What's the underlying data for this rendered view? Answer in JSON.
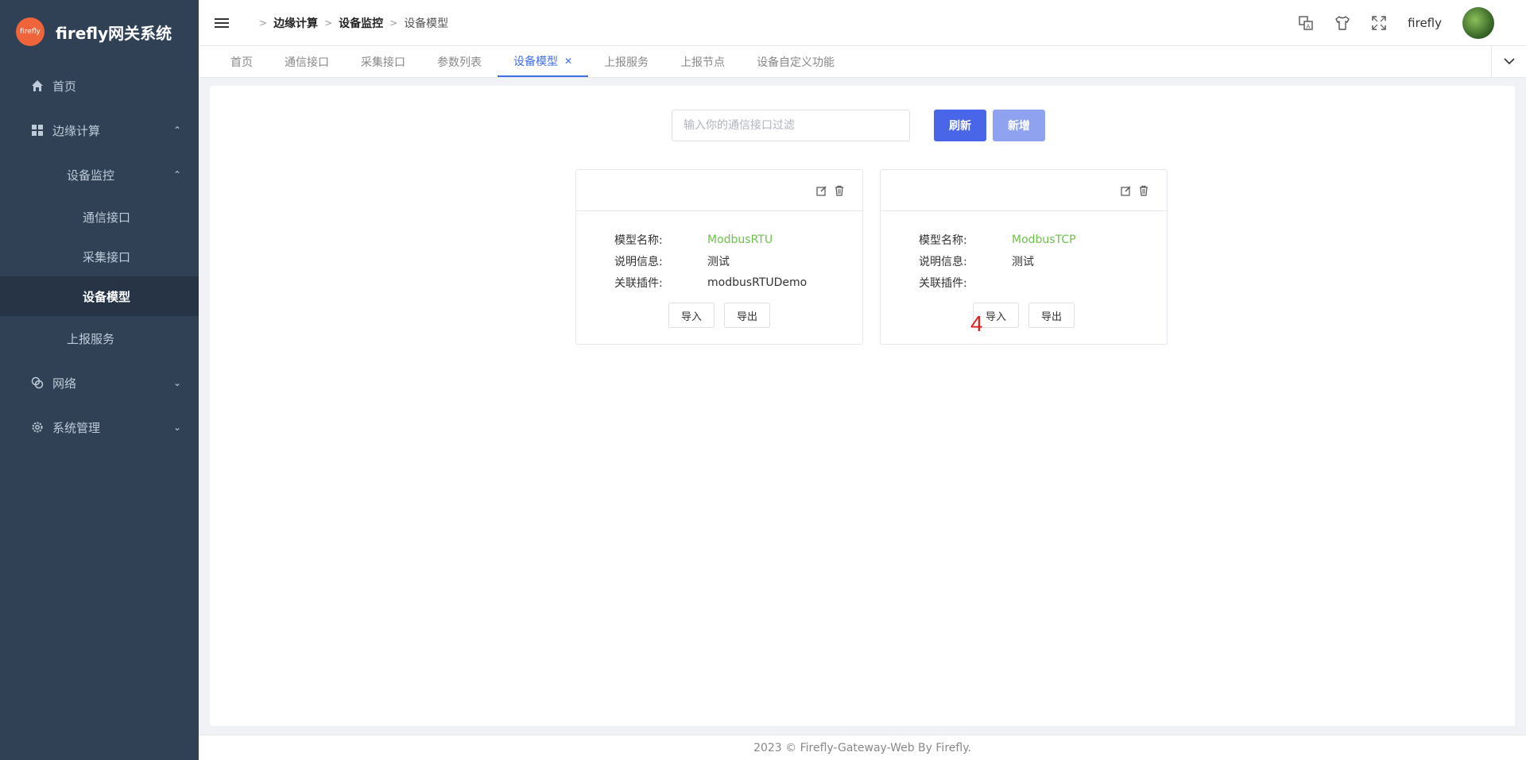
{
  "app": {
    "title": "firefly网关系统",
    "logo_text": "firefly"
  },
  "sidebar": {
    "items": [
      {
        "label": "首页",
        "icon": "home-icon"
      },
      {
        "label": "边缘计算",
        "icon": "grid-icon",
        "expanded": true
      },
      {
        "label": "设备监控",
        "expanded": true
      },
      {
        "label": "通信接口"
      },
      {
        "label": "采集接口"
      },
      {
        "label": "设备模型",
        "active": true
      },
      {
        "label": "上报服务"
      },
      {
        "label": "网络",
        "icon": "network-icon"
      },
      {
        "label": "系统管理",
        "icon": "gear-icon"
      }
    ]
  },
  "header": {
    "breadcrumb": [
      "边缘计算",
      "设备监控",
      "设备模型"
    ],
    "username": "firefly",
    "icons": [
      "translate-icon",
      "theme-shirt-icon",
      "fullscreen-icon"
    ]
  },
  "tabs": [
    {
      "label": "首页"
    },
    {
      "label": "通信接口"
    },
    {
      "label": "采集接口"
    },
    {
      "label": "参数列表"
    },
    {
      "label": "设备模型",
      "active": true
    },
    {
      "label": "上报服务"
    },
    {
      "label": "上报节点"
    },
    {
      "label": "设备自定义功能"
    }
  ],
  "toolbar": {
    "search_placeholder": "输入你的通信接口过滤",
    "search_value": "",
    "refresh_label": "刷新",
    "add_label": "新增"
  },
  "cards": [
    {
      "name_label": "模型名称:",
      "name": "ModbusRTU",
      "desc_label": "说明信息:",
      "desc": "测试",
      "plugin_label": "关联插件:",
      "plugin": "modbusRTUDemo",
      "import_label": "导入",
      "export_label": "导出"
    },
    {
      "name_label": "模型名称:",
      "name": "ModbusTCP",
      "desc_label": "说明信息:",
      "desc": "测试",
      "plugin_label": "关联插件:",
      "plugin": "",
      "import_label": "导入",
      "export_label": "导出",
      "overlay_mark": "4"
    }
  ],
  "footer": {
    "text": "2023 © Firefly-Gateway-Web By Firefly."
  },
  "colors": {
    "sidebar_bg": "#304156",
    "primary": "#4a66e8",
    "accent_green": "#6cc24a",
    "tab_active": "#3f6ee8"
  }
}
